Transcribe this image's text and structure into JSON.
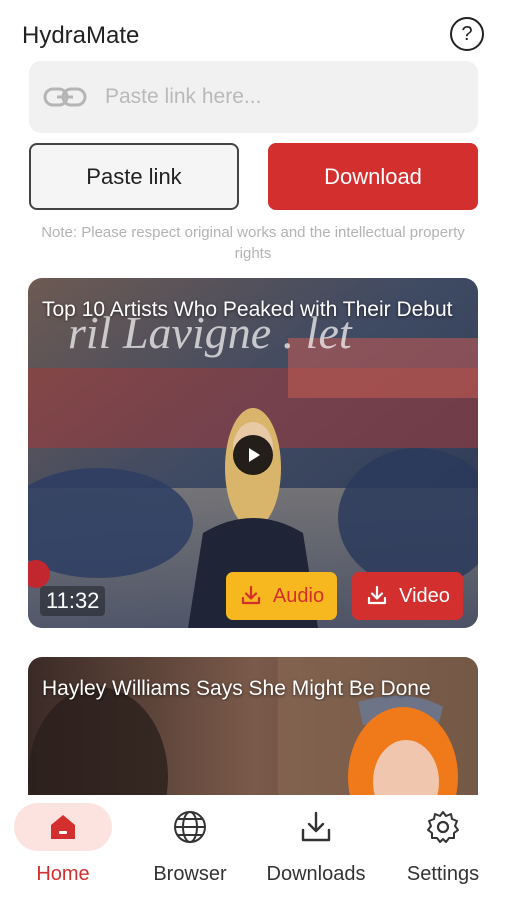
{
  "app": {
    "title": "HydraMate"
  },
  "header": {
    "help_icon": "question-circle-icon"
  },
  "link_input": {
    "placeholder": "Paste link here...",
    "value": ""
  },
  "buttons": {
    "paste": "Paste link",
    "download": "Download"
  },
  "note": "Note: Please respect original works and the intellectual property rights",
  "feed": [
    {
      "title": "Top 10 Artists Who Peaked with Their Debut",
      "duration": "11:32",
      "audio_label": "Audio",
      "video_label": "Video"
    },
    {
      "title": "Hayley Williams Says She Might Be Done"
    }
  ],
  "nav": {
    "items": [
      {
        "label": "Home",
        "icon": "home-icon",
        "active": true
      },
      {
        "label": "Browser",
        "icon": "globe-icon",
        "active": false
      },
      {
        "label": "Downloads",
        "icon": "download-icon",
        "active": false
      },
      {
        "label": "Settings",
        "icon": "gear-icon",
        "active": false
      }
    ]
  },
  "colors": {
    "accent": "#d32f2f",
    "audio": "#f7b81f",
    "nav_active_bg": "#fde3df"
  }
}
